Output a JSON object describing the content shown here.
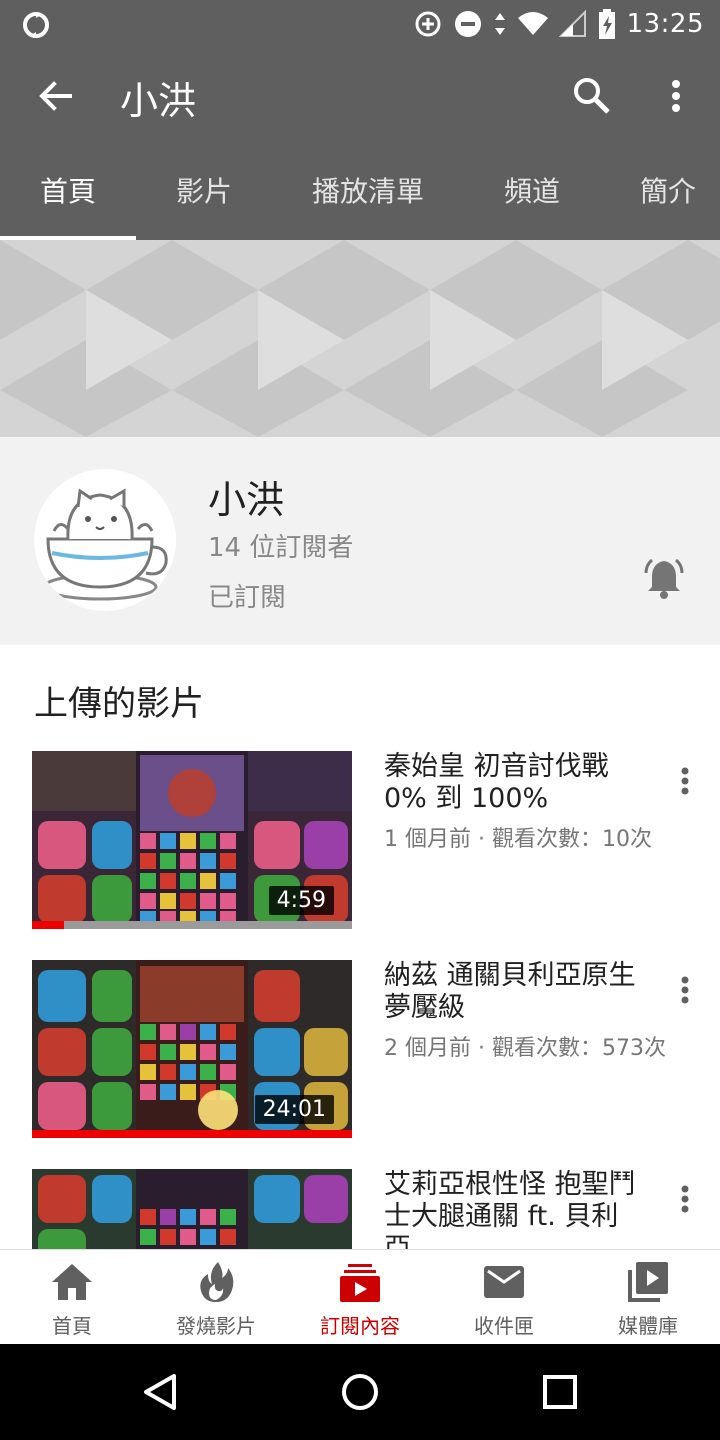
{
  "status_bar": {
    "time": "13:25"
  },
  "app_bar": {
    "title": "小洪"
  },
  "tabs": [
    {
      "label": "首頁",
      "active": true
    },
    {
      "label": "影片"
    },
    {
      "label": "播放清單"
    },
    {
      "label": "頻道"
    },
    {
      "label": "簡介"
    }
  ],
  "channel": {
    "name": "小洪",
    "subscribers": "14 位訂閱者",
    "status": "已訂閱"
  },
  "uploads": {
    "title": "上傳的影片",
    "videos": [
      {
        "title": "秦始皇 初音討伐戰 0% 到 100%",
        "meta": "1 個月前 · 觀看次數：10次",
        "duration": "4:59",
        "watched_fraction": 0.1
      },
      {
        "title": "納茲 通關貝利亞原生夢魘級",
        "meta": "2 個月前 · 觀看次數：573次",
        "duration": "24:01",
        "watched_fraction": 1.0
      },
      {
        "title": "艾莉亞根性怪 抱聖鬥士大腿通關 ft. 貝利亞",
        "meta": "",
        "duration": ""
      }
    ]
  },
  "bottom_nav": [
    {
      "label": "首頁",
      "icon": "home-icon"
    },
    {
      "label": "發燒影片",
      "icon": "trending-icon"
    },
    {
      "label": "訂閱內容",
      "icon": "subscriptions-icon",
      "active": true
    },
    {
      "label": "收件匣",
      "icon": "inbox-icon"
    },
    {
      "label": "媒體庫",
      "icon": "library-icon"
    }
  ],
  "colors": {
    "bar": "#5f5f5f",
    "accent": "#cc0000",
    "progress": "#ee0000"
  }
}
